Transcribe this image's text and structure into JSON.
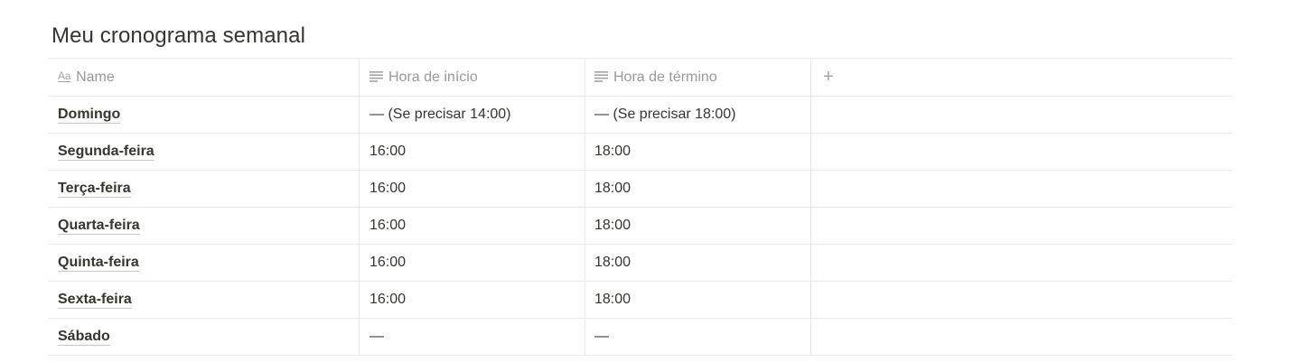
{
  "page": {
    "title": "Meu cronograma semanal"
  },
  "table": {
    "columns": [
      {
        "label": "Name",
        "icon": "title-aa-icon"
      },
      {
        "label": "Hora de início",
        "icon": "text-lines-icon"
      },
      {
        "label": "Hora de término",
        "icon": "text-lines-icon"
      }
    ],
    "add_column_symbol": "+",
    "rows": [
      {
        "name": "Domingo",
        "start": "— (Se precisar 14:00)",
        "end": "— (Se precisar 18:00)"
      },
      {
        "name": "Segunda-feira",
        "start": "16:00",
        "end": "18:00"
      },
      {
        "name": "Terça-feira",
        "start": "16:00",
        "end": "18:00"
      },
      {
        "name": "Quarta-feira",
        "start": "16:00",
        "end": "18:00"
      },
      {
        "name": "Quinta-feira",
        "start": "16:00",
        "end": "18:00"
      },
      {
        "name": "Sexta-feira",
        "start": "16:00",
        "end": "18:00"
      },
      {
        "name": "Sábado",
        "start": "—",
        "end": "—"
      }
    ]
  },
  "icons": {
    "name_column": "Aa"
  }
}
